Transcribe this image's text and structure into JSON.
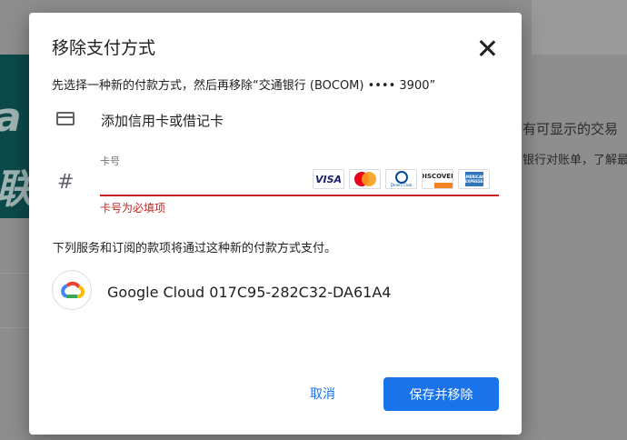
{
  "background": {
    "side_text_line1": "a",
    "side_text_line2": "联",
    "right_text_1": "有可显示的交易",
    "right_text_2": "银行对账单，了解最"
  },
  "dialog": {
    "title": "移除支付方式",
    "subtitle": "先选择一种新的付款方式，然后再移除“交通银行 (BOCOM) •••• 3900”",
    "add_card_label": "添加信用卡或借记卡",
    "card_number": {
      "label": "卡号",
      "value": "",
      "error": "卡号为必填项",
      "accepted_logos": [
        "VISA",
        "mastercard",
        "Diners Club International",
        "DISCOVER",
        "American Express"
      ]
    },
    "notice": "下列服务和订阅的款项将通过这种新的付款方式支付。",
    "service": {
      "name": "Google Cloud 017C95-282C32-DA61A4",
      "icon": "google-cloud-icon"
    },
    "buttons": {
      "cancel": "取消",
      "confirm": "保存并移除"
    }
  },
  "colors": {
    "primary": "#1a73e8",
    "error": "#c5221f",
    "text": "#202124"
  }
}
